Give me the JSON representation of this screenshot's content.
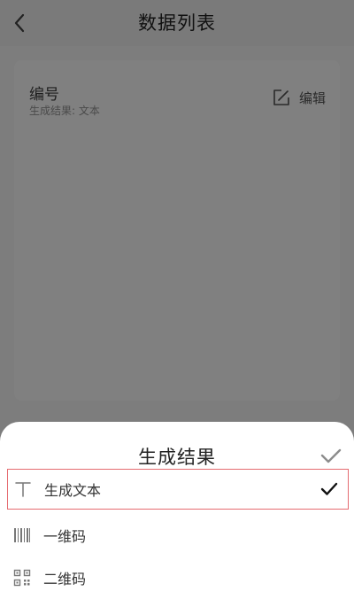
{
  "header": {
    "title": "数据列表",
    "back_icon": "chevron-left-icon"
  },
  "card": {
    "title": "编号",
    "subtitle": "生成结果: 文本",
    "edit_label": "编辑",
    "edit_icon": "edit-icon"
  },
  "sheet": {
    "title": "生成结果",
    "confirm_icon": "check-icon",
    "options": [
      {
        "label": "生成文本",
        "icon": "text-t-icon",
        "selected": true
      },
      {
        "label": "一维码",
        "icon": "barcode-icon",
        "selected": false
      },
      {
        "label": "二维码",
        "icon": "qr-code-icon",
        "selected": false
      }
    ]
  },
  "colors": {
    "overlay": "#7d7d7d",
    "sheet_background": "#ffffff",
    "selected_border": "#e56b70"
  }
}
